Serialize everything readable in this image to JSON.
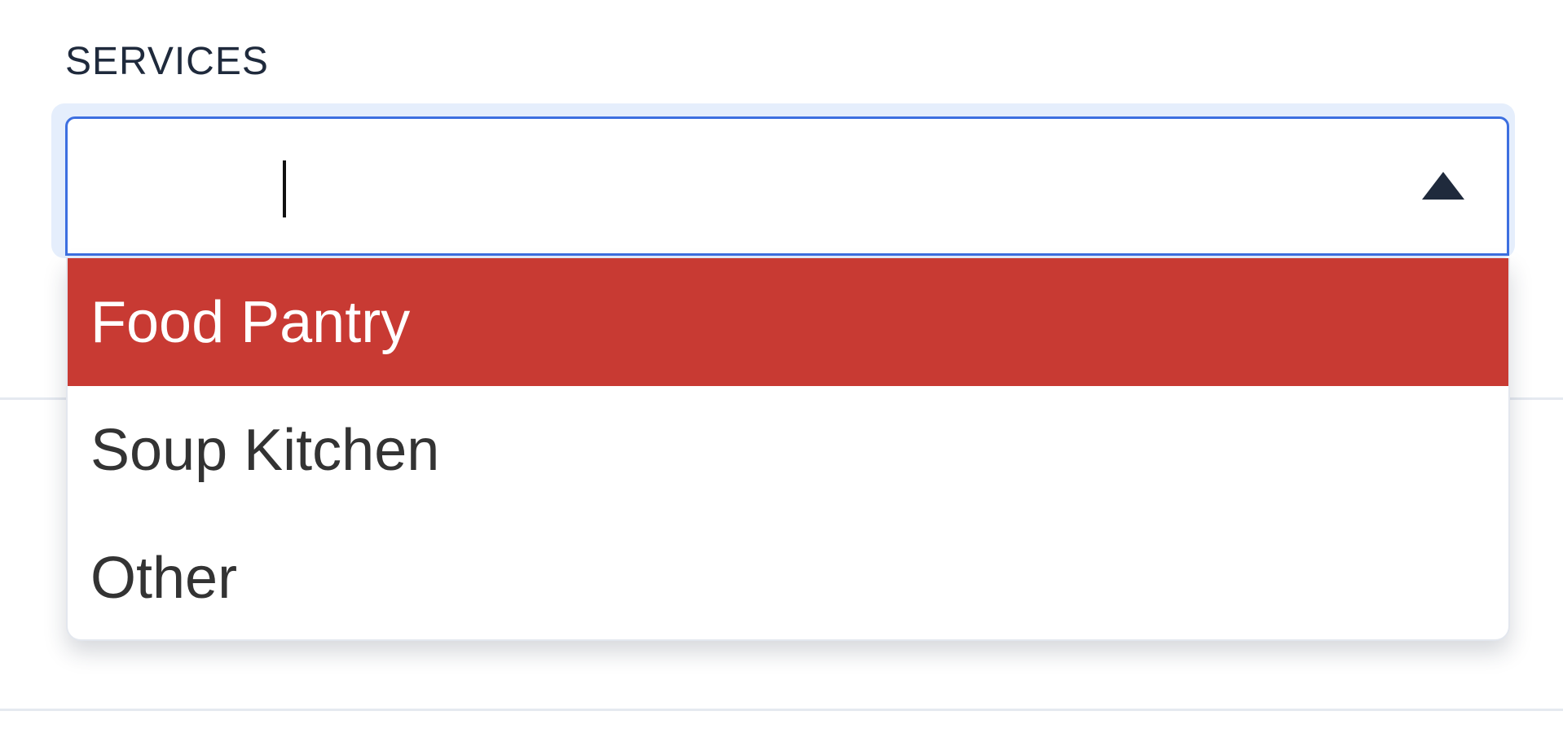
{
  "field": {
    "label": "SERVICES",
    "input_value": "",
    "dropdown_open": true
  },
  "options": [
    {
      "label": "Food Pantry",
      "highlighted": true
    },
    {
      "label": "Soup Kitchen",
      "highlighted": false
    },
    {
      "label": "Other",
      "highlighted": false
    }
  ],
  "colors": {
    "highlight": "#c83a33",
    "focus_border": "#3d6fe0",
    "label_text": "#1f2a3c"
  },
  "icons": {
    "dropdown_toggle": "caret-up-icon"
  }
}
